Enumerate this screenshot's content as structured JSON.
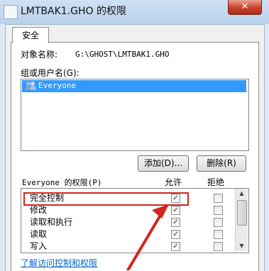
{
  "window": {
    "title": "LMTBAK1.GHO 的权限",
    "close_glyph": "✕"
  },
  "tabs": [
    {
      "label": "安全"
    }
  ],
  "object": {
    "label": "对象名称:",
    "value": "G:\\GHOST\\LMTBAK1.GHO"
  },
  "groups": {
    "label": "组或用户名(G):",
    "items": [
      {
        "name": "Everyone",
        "icon": "users-icon",
        "selected": true
      }
    ]
  },
  "buttons": {
    "add": "添加(D)...",
    "remove": "删除(R)"
  },
  "permissions": {
    "header": "Everyone 的权限(P)",
    "allow_header": "允许",
    "deny_header": "拒绝",
    "rows": [
      {
        "name": "完全控制",
        "allow": true,
        "deny": false
      },
      {
        "name": "修改",
        "allow": true,
        "deny": false
      },
      {
        "name": "读取和执行",
        "allow": true,
        "deny": false
      },
      {
        "name": "读取",
        "allow": true,
        "deny": false
      },
      {
        "name": "写入",
        "allow": true,
        "deny": false
      }
    ],
    "check_glyph": "✓"
  },
  "link": "了解访问控制和权限",
  "colors": {
    "selection": "#3399ff",
    "highlight": "#d4251a",
    "link": "#0066cc"
  }
}
